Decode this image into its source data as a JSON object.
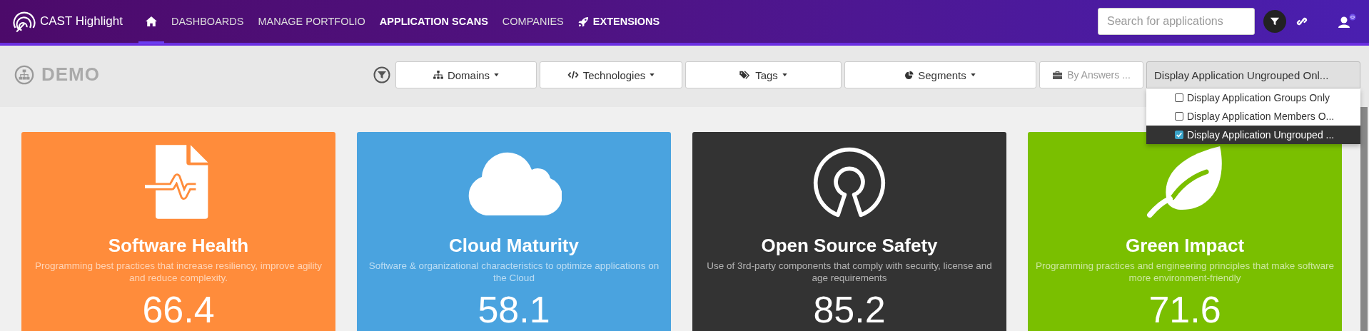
{
  "brand": {
    "name": "CAST Highlight"
  },
  "nav": [
    {
      "kind": "home",
      "selected": true
    },
    {
      "kind": "link",
      "label": "DASHBOARDS",
      "selected": false,
      "emphasized": false
    },
    {
      "kind": "link",
      "label": "MANAGE PORTFOLIO",
      "selected": false,
      "emphasized": false
    },
    {
      "kind": "link",
      "label": "APPLICATION SCANS",
      "selected": false,
      "emphasized": true
    },
    {
      "kind": "link",
      "label": "COMPANIES",
      "selected": false,
      "emphasized": false
    },
    {
      "kind": "rocket",
      "label": "EXTENSIONS",
      "selected": false,
      "emphasized": true
    }
  ],
  "search": {
    "placeholder": "Search for applications"
  },
  "page_title": "DEMO",
  "filters": [
    {
      "kind": "dropdown",
      "label": "Domains"
    },
    {
      "kind": "dropdown",
      "label": "Technologies"
    },
    {
      "kind": "dropdown",
      "label": "Tags"
    },
    {
      "kind": "dropdown",
      "label": "Segments"
    },
    {
      "kind": "muted",
      "label": "By Answers ..."
    }
  ],
  "grouping": {
    "label": "Display Application Ungrouped Onl...",
    "expanded": true,
    "options": [
      {
        "label": "Display Application Groups Only",
        "checked": false,
        "selected": false
      },
      {
        "label": "Display Application Members O...",
        "checked": false,
        "selected": false
      },
      {
        "label": "Display Application Ungrouped ...",
        "checked": true,
        "selected": true
      }
    ]
  },
  "cards": [
    {
      "title": "Software Health",
      "description": "Programming best practices that increase resiliency, improve agility and reduce complexity.",
      "value": "66.4",
      "color": "#ff8c3b"
    },
    {
      "title": "Cloud Maturity",
      "description": "Software & organizational characteristics to optimize applications on the Cloud",
      "value": "58.1",
      "color": "#4aa3df"
    },
    {
      "title": "Open Source Safety",
      "description": "Use of 3rd-party components that comply with security, license and age requirements",
      "value": "85.2",
      "color": "#333333"
    },
    {
      "title": "Green Impact",
      "description": "Programming practices and engineering principles that make software more environment-friendly",
      "value": "71.6",
      "color": "#7abf00"
    }
  ]
}
